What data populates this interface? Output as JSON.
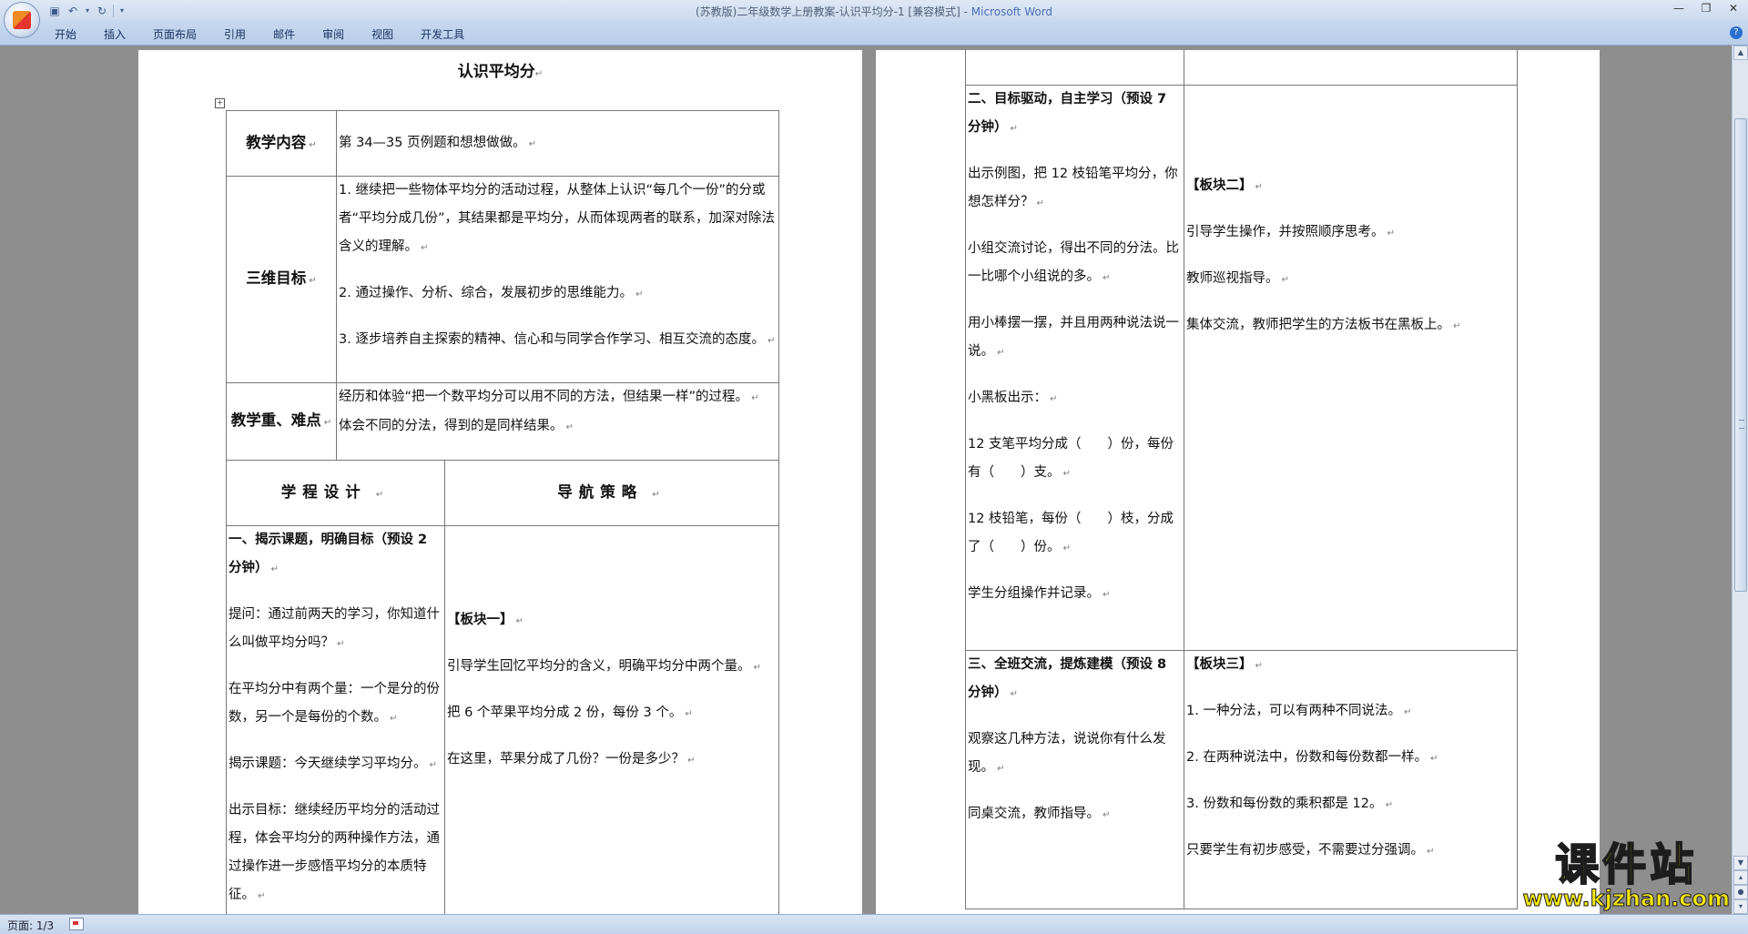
{
  "window": {
    "doc_title": "(苏教版)二年级数学上册教案-认识平均分-1 [兼容模式]",
    "separator": " - ",
    "app_name": "Microsoft Word"
  },
  "ribbon": {
    "tabs": [
      "开始",
      "插入",
      "页面布局",
      "引用",
      "邮件",
      "审阅",
      "视图",
      "开发工具"
    ]
  },
  "status": {
    "page": "页面: 1/3"
  },
  "watermark": {
    "main": "课件站",
    "url": "www.kjzhan.com"
  },
  "mark": "↵",
  "page1": {
    "title": "认识平均分",
    "content_label": "教学内容",
    "content_value": "第 34—35 页例题和想想做做。",
    "goals_label": "三维目标",
    "goals": [
      "1.  继续把一些物体平均分的活动过程，从整体上认识“每几个一份”的分或者“平均分成几份”，其结果都是平均分，从而体现两者的联系，加深对除法含义的理解。",
      "2.  通过操作、分析、综合，发展初步的思维能力。",
      "3.  逐步培养自主探索的精神、信心和与同学合作学习、相互交流的态度。"
    ],
    "keypoints_label": "教学重、难点",
    "keypoints": [
      "经历和体验“把一个数平均分可以用不同的方法，但结果一样”的过程。",
      "体会不同的分法，得到的是同样结果。"
    ],
    "col1_header": "学程设计",
    "col2_header": "导航策略",
    "left_col": [
      "一、揭示课题，明确目标（预设 2 分钟）",
      "提问：通过前两天的学习，你知道什么叫做平均分吗？",
      "在平均分中有两个量：一个是分的份数，另一个是每份的个数。",
      "揭示课题：今天继续学习平均分。",
      "出示目标：继续经历平均分的活动过程，体会平均分的两种操作方法，通过操作进一步感悟平均分的本质特征。"
    ],
    "right_col": [
      "【板块一】",
      "引导学生回忆平均分的含义，明确平均分中两个量。",
      "把 6 个苹果平均分成 2 份，每份 3 个。",
      "在这里，苹果分成了几份？一份是多少？"
    ]
  },
  "page2": {
    "sec2_left": [
      "二、目标驱动，自主学习（预设 7 分钟）",
      "出示例图，把 12 枝铅笔平均分，你想怎样分？",
      "小组交流讨论，得出不同的分法。比一比哪个小组说的多。",
      "用小棒摆一摆，并且用两种说法说一说。",
      "小黑板出示：",
      "12 支笔平均分成（　　）份，每份有（　　）支。",
      "12 枝铅笔，每份（　　）枝，分成了（　　）份。",
      "学生分组操作并记录。"
    ],
    "sec2_right": [
      "【板块二】",
      "引导学生操作，并按照顺序思考。",
      "教师巡视指导。",
      "集体交流，教师把学生的方法板书在黑板上。"
    ],
    "sec3_left": [
      "三、全班交流，提炼建模（预设 8 分钟）",
      "观察这几种方法，说说你有什么发现。",
      "同桌交流，教师指导。"
    ],
    "sec3_right": [
      "【板块三】",
      "1.  一种分法，可以有两种不同说法。",
      "2.  在两种说法中，份数和每份数都一样。",
      "3.  份数和每份数的乘积都是 12。",
      "只要学生有初步感受，不需要过分强调。"
    ]
  }
}
